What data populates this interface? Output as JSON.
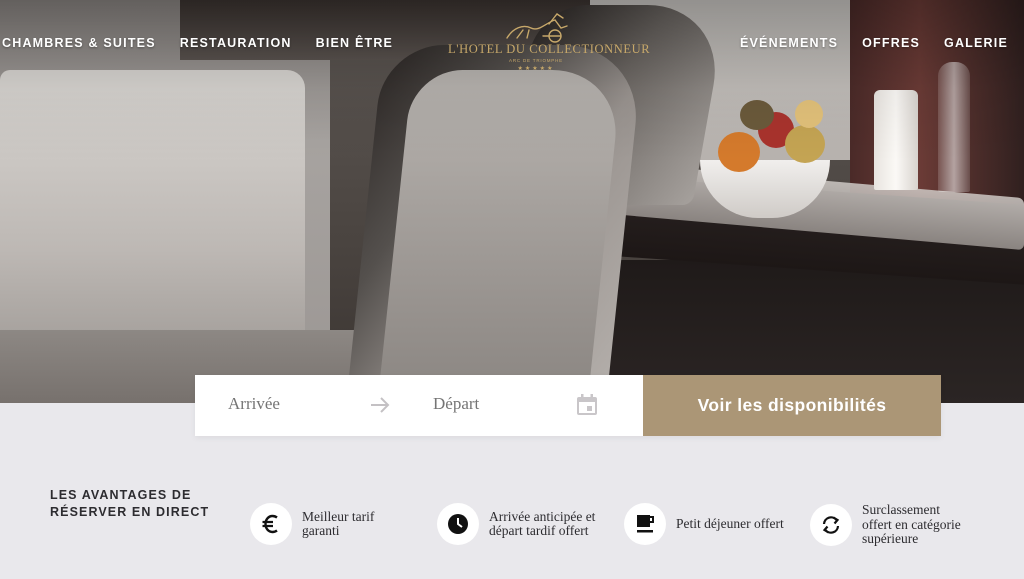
{
  "nav": {
    "left": [
      "CHAMBRES & SUITES",
      "RESTAURATION",
      "BIEN ÊTRE"
    ],
    "right": [
      "ÉVÉNEMENTS",
      "OFFRES",
      "GALERIE"
    ]
  },
  "logo": {
    "name": "L'HOTEL DU COLLECTIONNEUR",
    "subtitle": "ARC DE TRIOMPHE",
    "stars": "★★★★★"
  },
  "booking": {
    "arrival_placeholder": "Arrivée",
    "departure_placeholder": "Départ",
    "button_label": "Voir les disponibilités",
    "arrow_icon": "arrow-right-icon",
    "calendar_icon": "calendar-icon"
  },
  "advantages": {
    "title": "LES AVANTAGES DE RÉSERVER EN DIRECT",
    "items": [
      {
        "icon": "euro-icon",
        "label": "Meilleur tarif garanti"
      },
      {
        "icon": "clock-icon",
        "label": "Arrivée anticipée et départ tardif offert"
      },
      {
        "icon": "coffee-icon",
        "label": "Petit déjeuner offert"
      },
      {
        "icon": "upgrade-icon",
        "label": "Surclassement offert en catégorie supérieure"
      }
    ]
  },
  "colors": {
    "accent": "#ab9676",
    "logo_gold": "#c7a86a",
    "background": "#e9e8ec",
    "text": "#2d2c30"
  }
}
